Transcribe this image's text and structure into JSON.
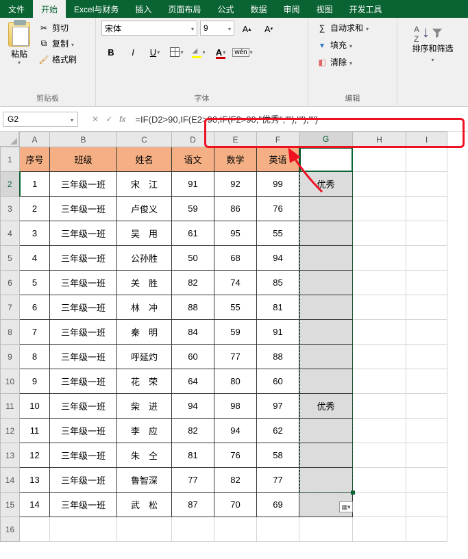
{
  "tabs": [
    "文件",
    "开始",
    "Excel与财务",
    "插入",
    "页面布局",
    "公式",
    "数据",
    "审阅",
    "视图",
    "开发工具"
  ],
  "active_tab": 1,
  "clipboard": {
    "paste": "粘贴",
    "cut": "剪切",
    "copy": "复制",
    "format_painter": "格式刷",
    "group": "剪贴板"
  },
  "font": {
    "name": "宋体",
    "size": "9",
    "group": "字体",
    "wen": "wén"
  },
  "editing": {
    "autosum": "自动求和",
    "fill": "填充",
    "clear": "清除",
    "group": "编辑",
    "sort_filter": "排序和筛选"
  },
  "namebox": "G2",
  "formula": "=IF(D2>90,IF(E2>90,IF(F2>90,\"优秀\",\"\"),\"\"),\"\")",
  "columns": [
    "A",
    "B",
    "C",
    "D",
    "E",
    "F",
    "G",
    "H",
    "I"
  ],
  "headers": {
    "a": "序号",
    "b": "班级",
    "c": "姓名",
    "d": "语文",
    "e": "数学",
    "f": "英语"
  },
  "rows": [
    {
      "n": "1",
      "cls": "三年级一班",
      "name": "宋　江",
      "d": "91",
      "e": "92",
      "f": "99",
      "g": "优秀"
    },
    {
      "n": "2",
      "cls": "三年级一班",
      "name": "卢俊义",
      "d": "59",
      "e": "86",
      "f": "76",
      "g": ""
    },
    {
      "n": "3",
      "cls": "三年级一班",
      "name": "吴　用",
      "d": "61",
      "e": "95",
      "f": "55",
      "g": ""
    },
    {
      "n": "4",
      "cls": "三年级一班",
      "name": "公孙胜",
      "d": "50",
      "e": "68",
      "f": "94",
      "g": ""
    },
    {
      "n": "5",
      "cls": "三年级一班",
      "name": "关　胜",
      "d": "82",
      "e": "74",
      "f": "85",
      "g": ""
    },
    {
      "n": "6",
      "cls": "三年级一班",
      "name": "林　冲",
      "d": "88",
      "e": "55",
      "f": "81",
      "g": ""
    },
    {
      "n": "7",
      "cls": "三年级一班",
      "name": "秦　明",
      "d": "84",
      "e": "59",
      "f": "91",
      "g": ""
    },
    {
      "n": "8",
      "cls": "三年级一班",
      "name": "呼延灼",
      "d": "60",
      "e": "77",
      "f": "88",
      "g": ""
    },
    {
      "n": "9",
      "cls": "三年级一班",
      "name": "花　荣",
      "d": "64",
      "e": "80",
      "f": "60",
      "g": ""
    },
    {
      "n": "10",
      "cls": "三年级一班",
      "name": "柴　进",
      "d": "94",
      "e": "98",
      "f": "97",
      "g": "优秀"
    },
    {
      "n": "11",
      "cls": "三年级一班",
      "name": "李　应",
      "d": "82",
      "e": "94",
      "f": "62",
      "g": ""
    },
    {
      "n": "12",
      "cls": "三年级一班",
      "name": "朱　仝",
      "d": "81",
      "e": "76",
      "f": "58",
      "g": ""
    },
    {
      "n": "13",
      "cls": "三年级一班",
      "name": "鲁智深",
      "d": "77",
      "e": "82",
      "f": "77",
      "g": ""
    },
    {
      "n": "14",
      "cls": "三年级一班",
      "name": "武　松",
      "d": "87",
      "e": "70",
      "f": "69",
      "g": ""
    }
  ]
}
